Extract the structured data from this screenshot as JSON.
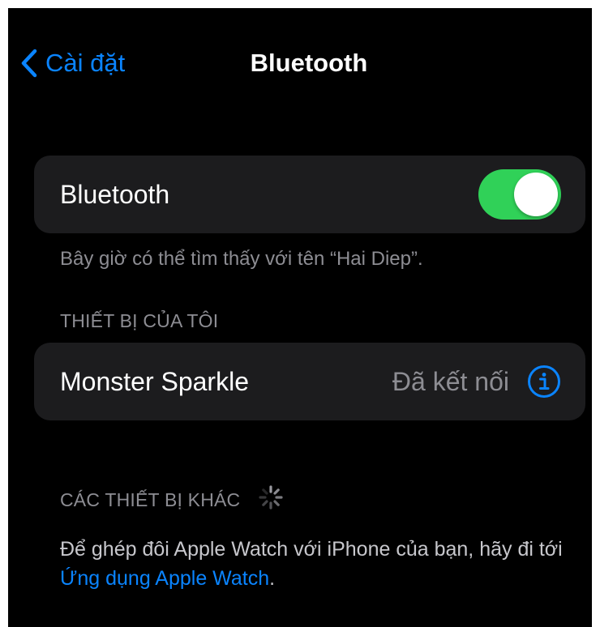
{
  "nav": {
    "back_label": "Cài đặt",
    "title": "Bluetooth"
  },
  "bluetooth": {
    "label": "Bluetooth",
    "enabled": true,
    "footer": "Bây giờ có thể tìm thấy với tên “Hai Diep”."
  },
  "my_devices": {
    "header": "THIẾT BỊ CỦA TÔI",
    "items": [
      {
        "name": "Monster Sparkle",
        "status": "Đã kết nối"
      }
    ]
  },
  "other_devices": {
    "header": "CÁC THIẾT BỊ KHÁC",
    "note_prefix": "Để ghép đôi Apple Watch với iPhone của bạn, hãy đi tới ",
    "note_link": "Ứng dụng Apple Watch",
    "note_suffix": "."
  },
  "icons": {
    "back": "chevron-left-icon",
    "info": "info-circle-icon",
    "spinner": "activity-spinner-icon"
  },
  "colors": {
    "background": "#000000",
    "group": "#1c1c1e",
    "accent": "#0a84ff",
    "toggle_on": "#30d158",
    "secondary_text": "#8d8d93"
  }
}
